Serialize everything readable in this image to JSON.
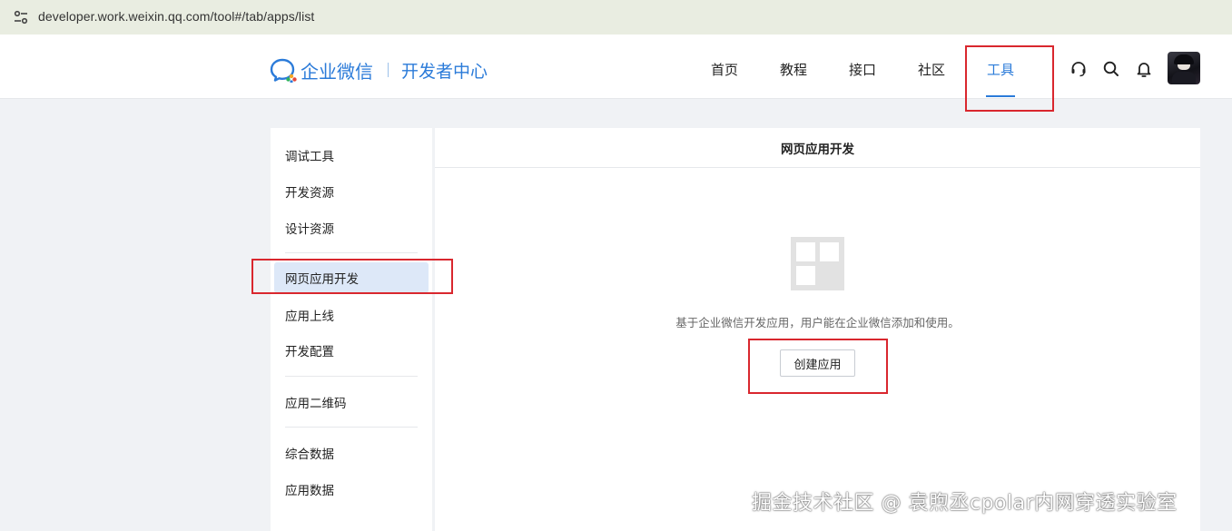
{
  "browser": {
    "url": "developer.work.weixin.qq.com/tool#/tab/apps/list",
    "site_info_icon": "tune-icon"
  },
  "header": {
    "brand": "企业微信",
    "subtitle": "开发者中心",
    "nav": [
      {
        "label": "首页"
      },
      {
        "label": "教程"
      },
      {
        "label": "接口"
      },
      {
        "label": "社区"
      },
      {
        "label": "工具",
        "active": true
      }
    ],
    "icons": [
      "headset-icon",
      "search-icon",
      "bell-icon"
    ],
    "accent_color": "#2b7bd9"
  },
  "sidebar": {
    "items": [
      {
        "label": "调试工具"
      },
      {
        "label": "开发资源"
      },
      {
        "label": "设计资源"
      },
      {
        "label": "网页应用开发",
        "active": true
      },
      {
        "label": "应用上线"
      },
      {
        "label": "开发配置"
      },
      {
        "label": "应用二维码"
      },
      {
        "label": "综合数据"
      },
      {
        "label": "应用数据"
      }
    ]
  },
  "main": {
    "title": "网页应用开发",
    "empty_icon": "grid-app-icon",
    "description": "基于企业微信开发应用，用户能在企业微信添加和使用。",
    "create_button": "创建应用"
  },
  "highlight_color": "#d9272e",
  "watermark": "掘金技术社区 @ 袁煦丞cpolar内网穿透实验室"
}
